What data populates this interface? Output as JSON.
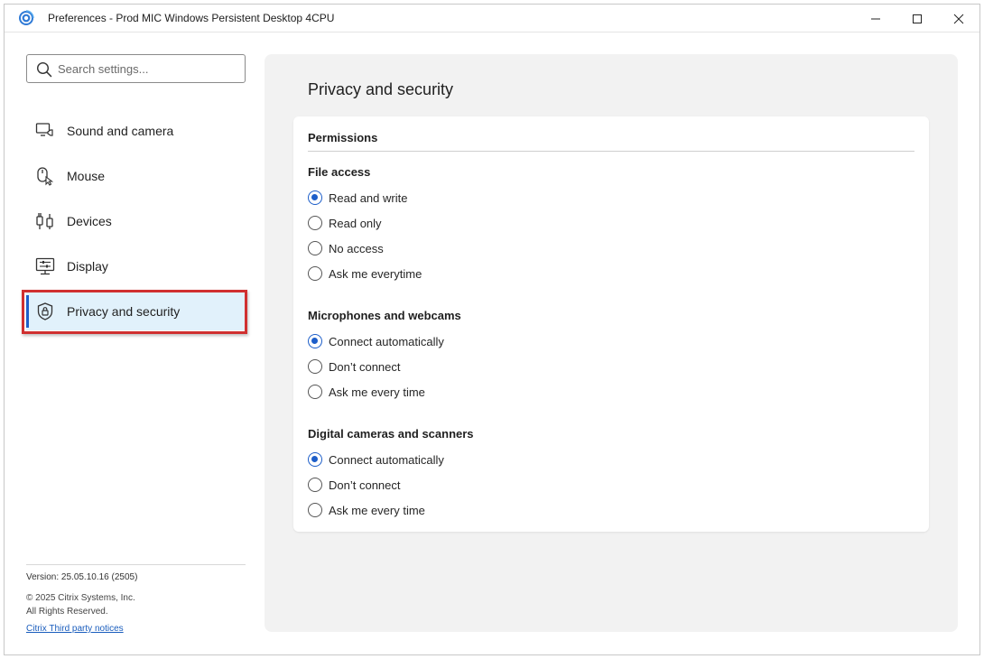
{
  "window": {
    "title": "Preferences - Prod MIC Windows Persistent Desktop 4CPU",
    "accent_color": "#1d5ec9"
  },
  "search": {
    "placeholder": "Search settings...",
    "value": ""
  },
  "sidebar": {
    "items": [
      {
        "label": "Sound and camera",
        "icon": "sound-camera-icon"
      },
      {
        "label": "Mouse",
        "icon": "mouse-icon"
      },
      {
        "label": "Devices",
        "icon": "devices-icon"
      },
      {
        "label": "Display",
        "icon": "display-icon"
      },
      {
        "label": "Privacy and security",
        "icon": "shield-lock-icon",
        "active": true
      }
    ],
    "version": "Version: 25.05.10.16 (2505)",
    "copyright_line1": "© 2025 Citrix Systems, Inc.",
    "copyright_line2": "All Rights Reserved.",
    "notices_link": "Citrix Third party notices"
  },
  "main": {
    "title": "Privacy and security",
    "card": {
      "heading": "Permissions",
      "groups": [
        {
          "title": "File access",
          "options": [
            "Read and write",
            "Read only",
            "No access",
            "Ask me everytime"
          ],
          "selected": "Read and write"
        },
        {
          "title": "Microphones and webcams",
          "options": [
            "Connect automatically",
            "Don’t connect",
            "Ask me every time"
          ],
          "selected": "Connect automatically"
        },
        {
          "title": "Digital cameras and scanners",
          "options": [
            "Connect automatically",
            "Don’t connect",
            "Ask me every time"
          ],
          "selected": "Connect automatically"
        }
      ]
    }
  }
}
